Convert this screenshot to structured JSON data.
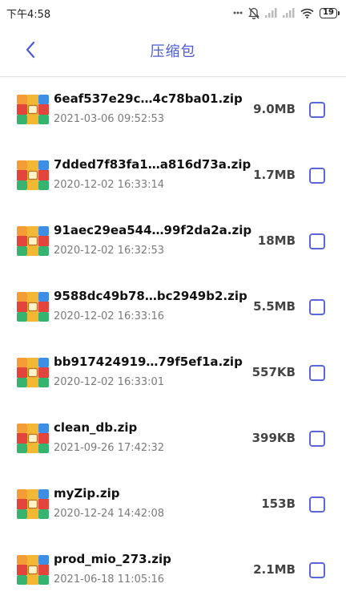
{
  "status_bar": {
    "time": "下午4:58",
    "battery": "19",
    "icons": [
      "alarm-off-icon",
      "signal-icon",
      "signal-icon",
      "wifi-icon",
      "battery-icon"
    ]
  },
  "header": {
    "title": "压缩包",
    "back_icon": "chevron-left-icon",
    "accent_color": "#4a5bd2"
  },
  "files": [
    {
      "name": "6eaf537e29c…4c78ba01.zip",
      "date": "2021-03-06 09:52:53",
      "size": "9.0MB",
      "checked": false
    },
    {
      "name": "7dded7f83fa1…a816d73a.zip",
      "date": "2020-12-02 16:33:14",
      "size": "1.7MB",
      "checked": false
    },
    {
      "name": "91aec29ea544…99f2da2a.zip",
      "date": "2020-12-02 16:32:53",
      "size": "18MB",
      "checked": false
    },
    {
      "name": "9588dc49b78…bc2949b2.zip",
      "date": "2020-12-02 16:33:16",
      "size": "5.5MB",
      "checked": false
    },
    {
      "name": "bb917424919…79f5ef1a.zip",
      "date": "2020-12-02 16:33:01",
      "size": "557KB",
      "checked": false
    },
    {
      "name": "clean_db.zip",
      "date": "2021-09-26 17:42:32",
      "size": "399KB",
      "checked": false
    },
    {
      "name": "myZip.zip",
      "date": "2020-12-24 14:42:08",
      "size": "153B",
      "checked": false
    },
    {
      "name": "prod_mio_273.zip",
      "date": "2021-06-18 11:05:16",
      "size": "2.1MB",
      "checked": false
    }
  ]
}
